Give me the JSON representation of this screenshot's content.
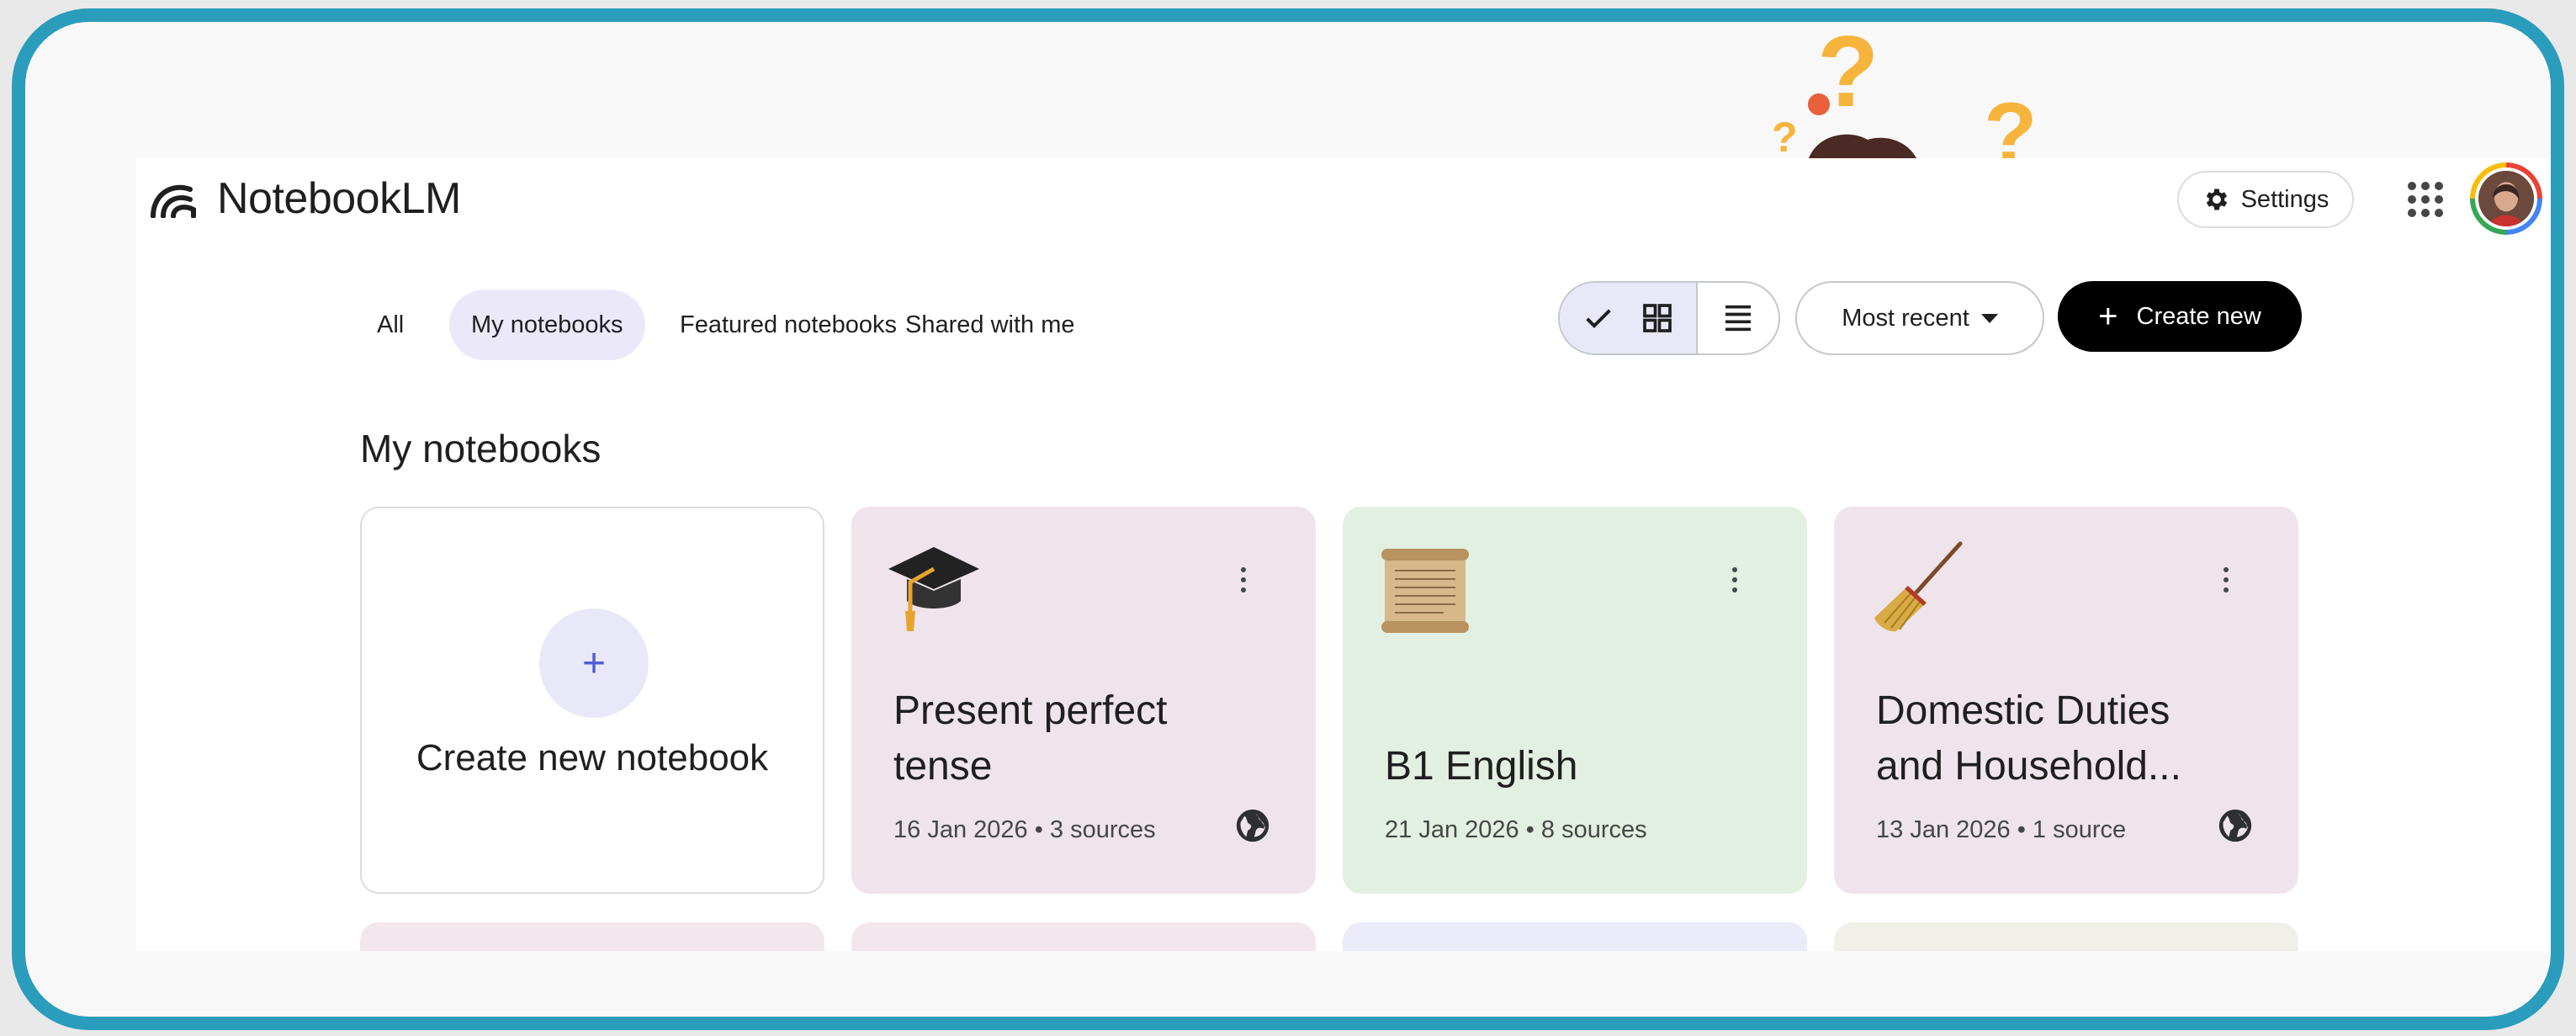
{
  "app": {
    "name": "NotebookLM"
  },
  "header": {
    "settings_label": "Settings"
  },
  "tabs": [
    {
      "label": "All",
      "active": false
    },
    {
      "label": "My notebooks",
      "active": true
    },
    {
      "label": "Featured notebooks",
      "active": false
    },
    {
      "label": "Shared with me",
      "active": false
    }
  ],
  "toolbar": {
    "view_mode": "grid",
    "sort_label": "Most recent",
    "create_label": "Create new"
  },
  "section": {
    "title": "My notebooks"
  },
  "new_card": {
    "label": "Create new notebook"
  },
  "notebooks": [
    {
      "icon": "graduation-cap-icon",
      "title_line1": "Present perfect",
      "title_line2": "tense",
      "meta": "16 Jan 2026 • 3 sources",
      "shared": true,
      "color": "#f0e4ec"
    },
    {
      "icon": "scroll-icon",
      "title_line1": "",
      "title_line2": "B1 English",
      "meta": "21 Jan 2026 • 8 sources",
      "shared": false,
      "color": "#e2f0e1"
    },
    {
      "icon": "broom-icon",
      "title_line1": "Domestic Duties",
      "title_line2": "and Household...",
      "meta": "13 Jan 2026 • 1 source",
      "shared": true,
      "color": "#f0e4ec"
    }
  ],
  "next_row_colors": [
    "#f3e6ec",
    "#f3e6ec",
    "#ecebfa",
    "#f0f0e8"
  ],
  "colors": {
    "frame_border": "#2a9cbc",
    "accent": "#4f5fd5",
    "active_tab": "#ebe9f9",
    "create_button": "#000000"
  }
}
